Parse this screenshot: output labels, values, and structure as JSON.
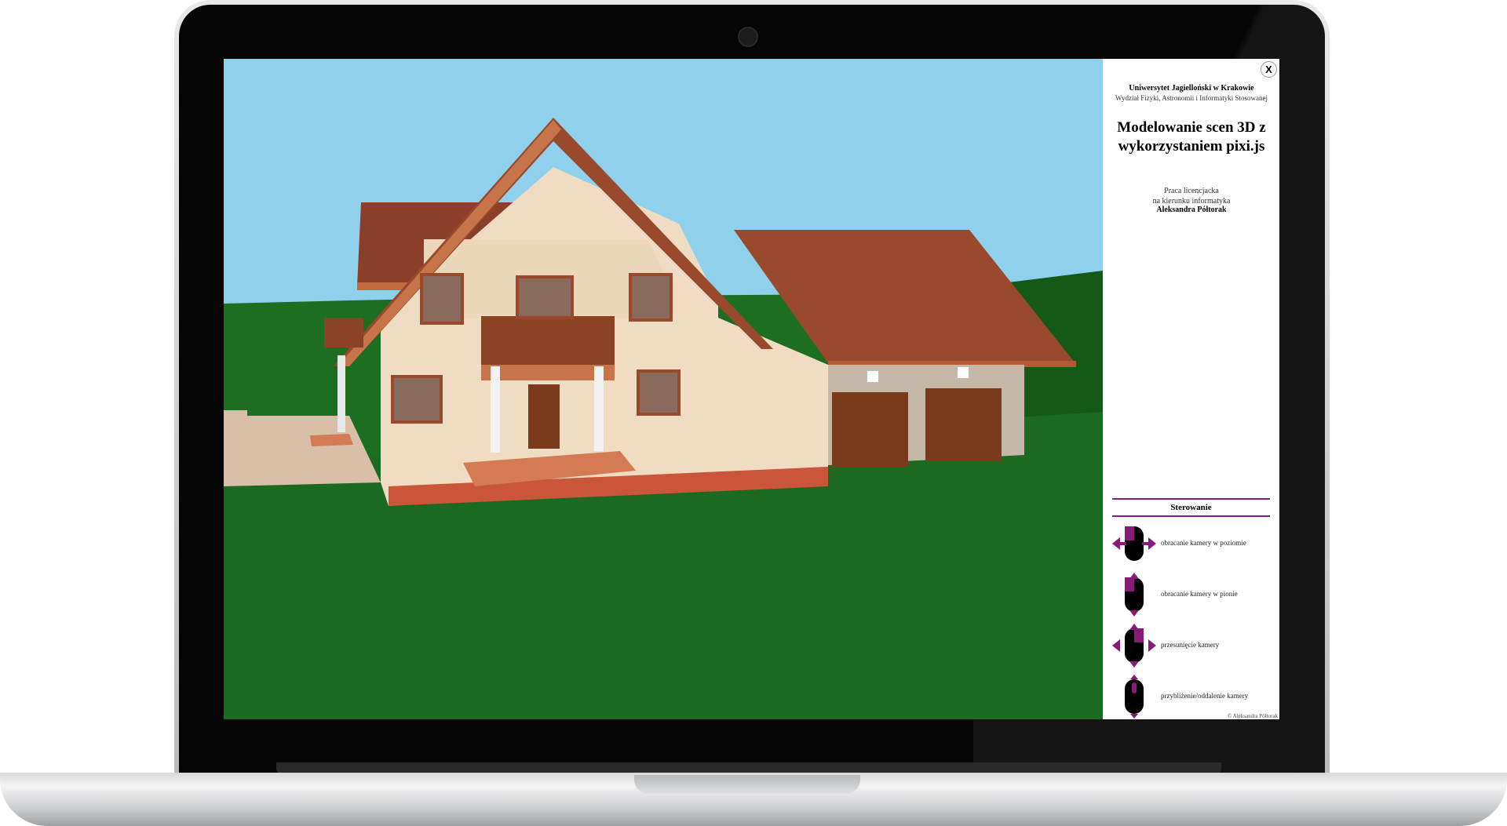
{
  "panel": {
    "close_label": "X",
    "university": "Uniwersytet Jagielloński w Krakowie",
    "faculty": "Wydział Fizyki, Astronomii i Informatyki Stosowanej",
    "title": "Modelowanie scen 3D z wykorzystaniem pixi.js",
    "thesis_line1": "Praca licencjacka",
    "thesis_line2": "na kierunku informatyka",
    "author": "Aleksandra Półtorak",
    "controls_heading": "Sterowanie",
    "controls": [
      {
        "icon": "mouse-left-drag-horizontal-icon",
        "label": "obracanie kamery w poziomie"
      },
      {
        "icon": "mouse-left-drag-vertical-icon",
        "label": "obracanie kamery w pionie"
      },
      {
        "icon": "mouse-right-drag-icon",
        "label": "przesunięcie kamery"
      },
      {
        "icon": "mouse-scroll-icon",
        "label": "przybliżenie/oddalenie kamery"
      }
    ],
    "copyright": "© Aleksandra Półtorak"
  },
  "colors": {
    "sky": "#8fd1ec",
    "grass": "#1c6a1e",
    "roof": "#9a4a2c",
    "wall": "#efdcc2",
    "accent": "#8a1a7a"
  }
}
